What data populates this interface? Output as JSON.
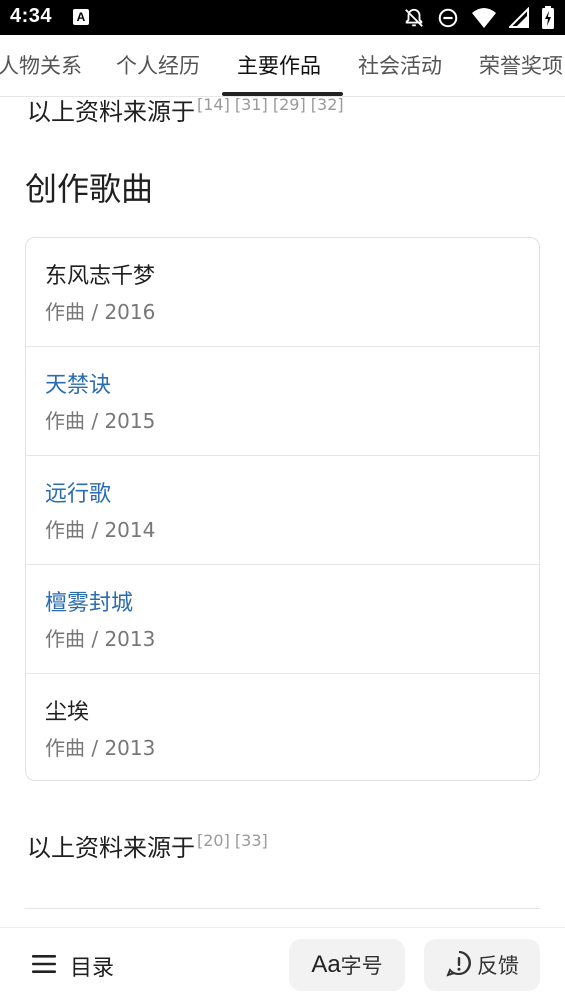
{
  "status_bar": {
    "time": "4:34",
    "notification_icon": "A",
    "icons": [
      "notifications-off-icon",
      "do-not-disturb-icon",
      "wifi-icon",
      "cell-signal-icon",
      "battery-charging-icon"
    ]
  },
  "tabs": [
    {
      "label": "人物关系",
      "active": false
    },
    {
      "label": "个人经历",
      "active": false
    },
    {
      "label": "主要作品",
      "active": true
    },
    {
      "label": "社会活动",
      "active": false
    },
    {
      "label": "荣誉奖项",
      "active": false
    }
  ],
  "top_source": {
    "text": "以上资料来源于",
    "citations": "[14] [31] [29] [32]"
  },
  "section_title": "创作歌曲",
  "songs": [
    {
      "title": "东风志千梦",
      "meta": "作曲 / 2016",
      "link": false
    },
    {
      "title": "天禁诀",
      "meta": "作曲 / 2015",
      "link": true
    },
    {
      "title": "远行歌",
      "meta": "作曲 / 2014",
      "link": true
    },
    {
      "title": "檀雾封城",
      "meta": "作曲 / 2013",
      "link": true
    },
    {
      "title": "尘埃",
      "meta": "作曲 / 2013",
      "link": false
    }
  ],
  "bottom_source": {
    "text": "以上资料来源于",
    "citations": "[20] [33]"
  },
  "bottom_bar": {
    "toc_label": "目录",
    "font_aa": "Aa",
    "font_label": "字号",
    "feedback_label": "反馈"
  },
  "colors": {
    "link": "#2b6cb0",
    "meta": "#777777",
    "citation": "#9a9a9a"
  }
}
